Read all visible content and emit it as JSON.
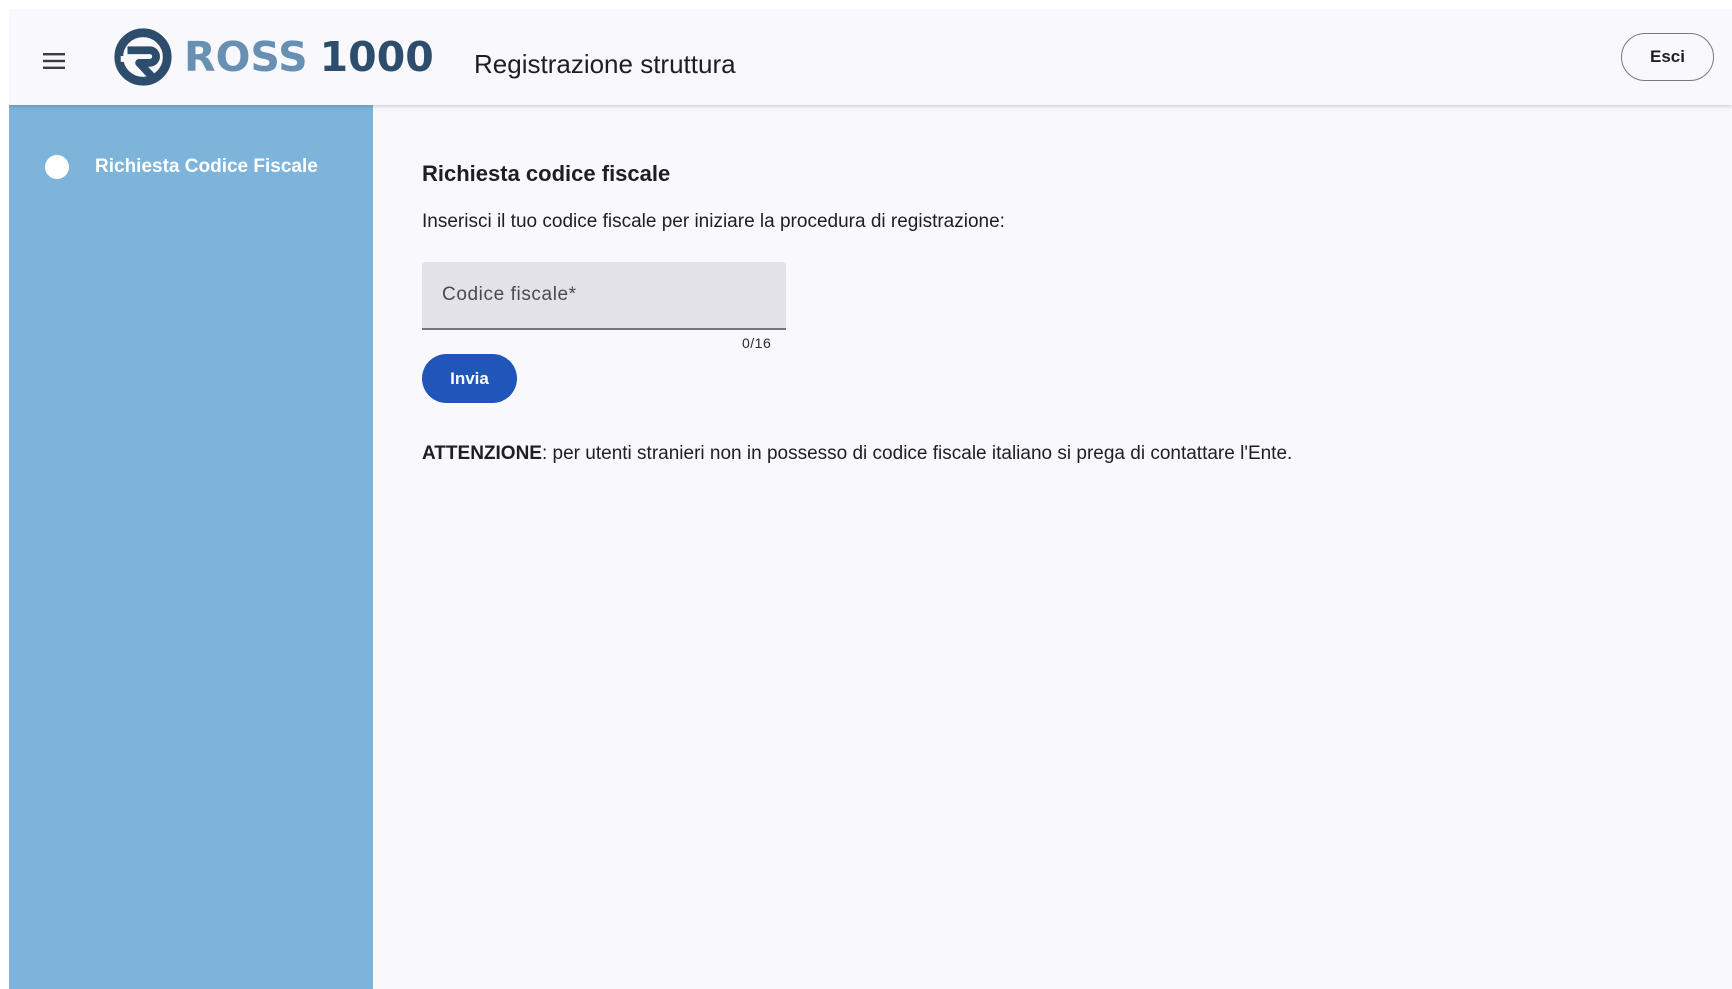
{
  "header": {
    "menu_icon": "hamburger-menu-icon",
    "logo": {
      "word1": "ROSS",
      "word2": "1000"
    },
    "title": "Registrazione struttura",
    "logout_label": "Esci"
  },
  "sidebar": {
    "steps": [
      {
        "label": "Richiesta Codice Fiscale",
        "active": true
      }
    ]
  },
  "main": {
    "title": "Richiesta codice fiscale",
    "description": "Inserisci il tuo codice fiscale per iniziare la procedura di registrazione:",
    "field": {
      "placeholder": "Codice fiscale*",
      "value": "",
      "counter": "0/16"
    },
    "submit_label": "Invia",
    "notice": {
      "strong": "ATTENZIONE",
      "text": ": per utenti stranieri non in possesso di codice fiscale italiano si prega di contattare l'Ente."
    }
  },
  "colors": {
    "sidebar": "#7eb3da",
    "primary_button": "#1f56b8",
    "logo_light": "#6790b3",
    "logo_dark": "#2e4d6c",
    "background": "#f8f8fd"
  }
}
